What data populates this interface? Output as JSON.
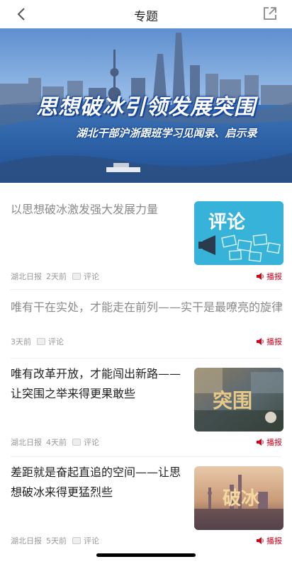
{
  "navbar": {
    "title": "专题",
    "back_icon": "chevron-left-icon",
    "share_icon": "share-icon"
  },
  "banner": {
    "title": "思想破冰引领发展突围",
    "subtitle": "湖北干部沪浙跟班学习见闻录、启示录"
  },
  "articles": [
    {
      "title": "以思想破冰激发强大发展力量",
      "source": "湖北日报",
      "time": "2天前",
      "comment_label": "评论",
      "broadcast_label": "播报",
      "thumb_text": "评论",
      "read": true
    },
    {
      "title": "唯有干在实处，才能走在前列——实干是最嘹亮的旋律",
      "source": "",
      "time": "3天前",
      "comment_label": "评论",
      "broadcast_label": "播报",
      "read": true
    },
    {
      "title": "唯有改革开放，才能闯出新路——让突围之举来得更果敢些",
      "source": "湖北日报",
      "time": "4天前",
      "comment_label": "评论",
      "broadcast_label": "播报",
      "thumb_text": "突围",
      "read": false
    },
    {
      "title": "差距就是奋起直追的空间——让思想破冰来得更猛烈些",
      "source": "湖北日报",
      "time": "5天前",
      "comment_label": "评论",
      "broadcast_label": "播报",
      "thumb_text": "破冰",
      "read": false
    }
  ],
  "colors": {
    "accent_red": "#d0021b",
    "read_title": "#8a8a8a",
    "unread_title": "#222222"
  }
}
